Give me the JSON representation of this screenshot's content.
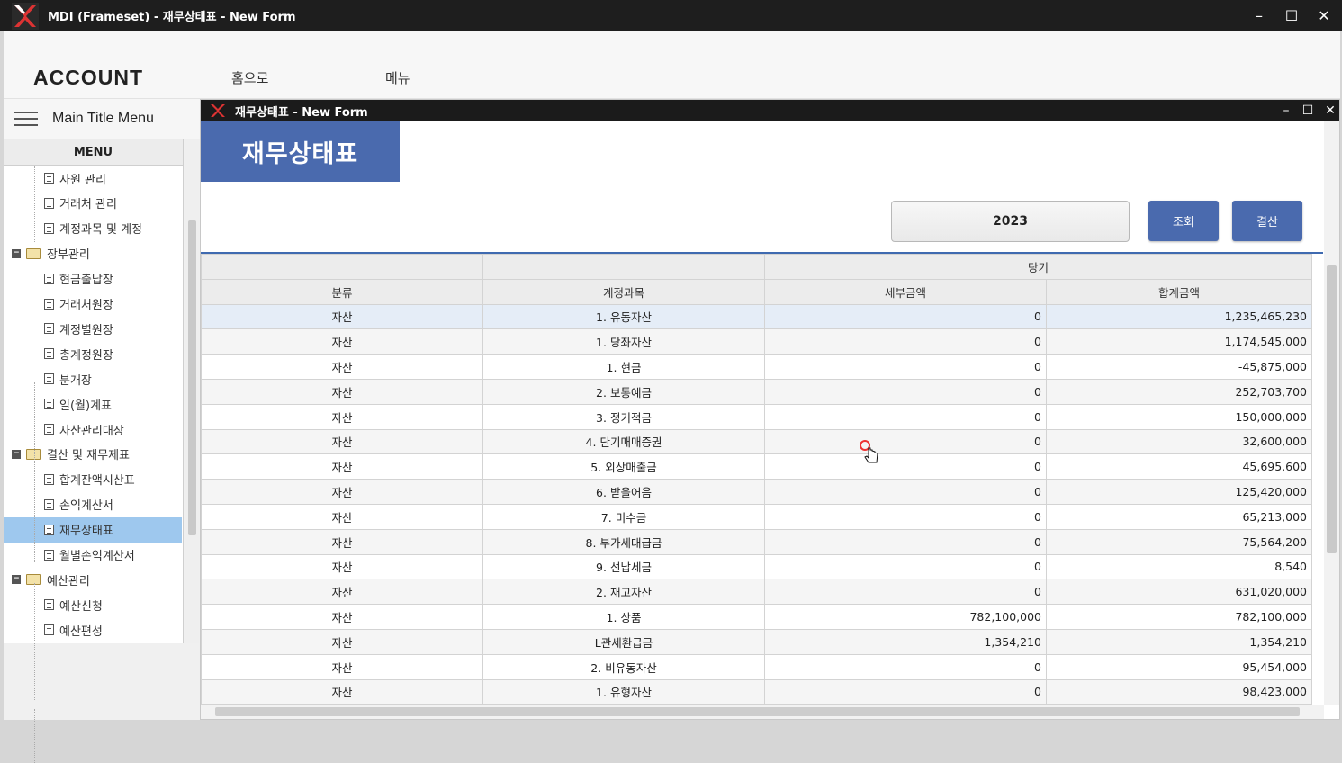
{
  "window": {
    "title": "MDI (Frameset) - 재무상태표 - New Form",
    "min_label": "–",
    "max_label": "☐",
    "close_label": "✕"
  },
  "topnav": {
    "brand": "ACCOUNT",
    "home": "홈으로",
    "menu": "메뉴"
  },
  "sidebar": {
    "title": "Main Title Menu",
    "tree_header": "MENU",
    "items": [
      {
        "label": "사원 관리",
        "type": "doc",
        "selected": false
      },
      {
        "label": "거래처 관리",
        "type": "doc",
        "selected": false
      },
      {
        "label": "계정과목 및 계정",
        "type": "doc",
        "selected": false
      },
      {
        "label": "장부관리",
        "type": "folder",
        "selected": false
      },
      {
        "label": "현금출납장",
        "type": "doc",
        "selected": false
      },
      {
        "label": "거래처원장",
        "type": "doc",
        "selected": false
      },
      {
        "label": "계정별원장",
        "type": "doc",
        "selected": false
      },
      {
        "label": "총계정원장",
        "type": "doc",
        "selected": false
      },
      {
        "label": "분개장",
        "type": "doc",
        "selected": false
      },
      {
        "label": "일(월)계표",
        "type": "doc",
        "selected": false
      },
      {
        "label": "자산관리대장",
        "type": "doc",
        "selected": false
      },
      {
        "label": "결산 및 재무제표",
        "type": "folder",
        "selected": false
      },
      {
        "label": "합계잔액시산표",
        "type": "doc",
        "selected": false
      },
      {
        "label": "손익계산서",
        "type": "doc",
        "selected": false
      },
      {
        "label": "재무상태표",
        "type": "doc",
        "selected": true
      },
      {
        "label": "월별손익계산서",
        "type": "doc",
        "selected": false
      },
      {
        "label": "예산관리",
        "type": "folder",
        "selected": false
      },
      {
        "label": "예산신청",
        "type": "doc",
        "selected": false
      },
      {
        "label": "예산편성",
        "type": "doc",
        "selected": false
      }
    ]
  },
  "child": {
    "title": "재무상태표 - New Form",
    "form_title": "재무상태표",
    "year": "2023",
    "query_button": "조회",
    "close_button": "결산",
    "group_header": "당기",
    "columns": [
      "분류",
      "계정과목",
      "세부금액",
      "합계금액"
    ],
    "rows": [
      [
        "자산",
        "1. 유동자산",
        "0",
        "1,235,465,230"
      ],
      [
        "자산",
        "1. 당좌자산",
        "0",
        "1,174,545,000"
      ],
      [
        "자산",
        "1. 현금",
        "0",
        "-45,875,000"
      ],
      [
        "자산",
        "2. 보통예금",
        "0",
        "252,703,700"
      ],
      [
        "자산",
        "3. 정기적금",
        "0",
        "150,000,000"
      ],
      [
        "자산",
        "4. 단기매매증권",
        "0",
        "32,600,000"
      ],
      [
        "자산",
        "5. 외상매출금",
        "0",
        "45,695,600"
      ],
      [
        "자산",
        "6. 받을어음",
        "0",
        "125,420,000"
      ],
      [
        "자산",
        "7. 미수금",
        "0",
        "65,213,000"
      ],
      [
        "자산",
        "8. 부가세대급금",
        "0",
        "75,564,200"
      ],
      [
        "자산",
        "9. 선납세금",
        "0",
        "8,540"
      ],
      [
        "자산",
        "2. 재고자산",
        "0",
        "631,020,000"
      ],
      [
        "자산",
        "1. 상품",
        "782,100,000",
        "782,100,000"
      ],
      [
        "자산",
        "L관세환급금",
        "1,354,210",
        "1,354,210"
      ],
      [
        "자산",
        "2. 비유동자산",
        "0",
        "95,454,000"
      ],
      [
        "자산",
        "1. 유형자산",
        "0",
        "98,423,000"
      ]
    ]
  },
  "colors": {
    "accent": "#4a6aae",
    "titlebar": "#1e1e1e",
    "selection": "#9ec8ee"
  },
  "icons": [
    "app-logo-icon",
    "hamburger-icon",
    "folder-icon",
    "document-icon",
    "minimize-icon",
    "maximize-icon",
    "close-icon",
    "hand-cursor-icon"
  ]
}
